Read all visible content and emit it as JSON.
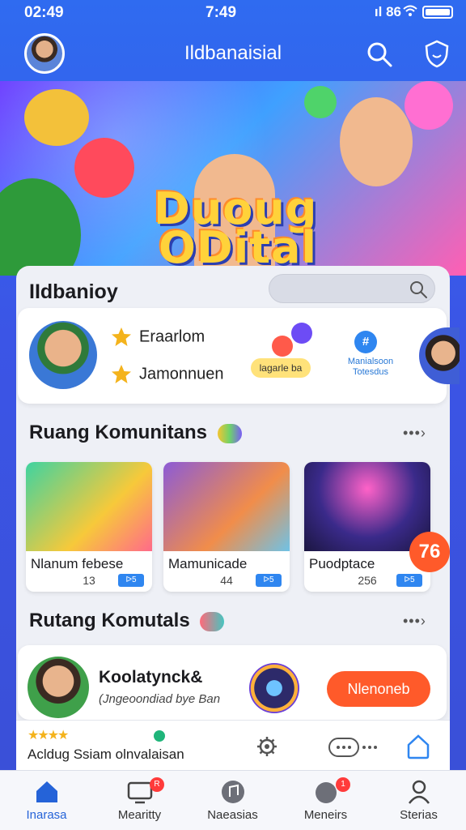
{
  "status_bar": {
    "time_left": "02:49",
    "time_center": "7:49",
    "signal": "ıl 86"
  },
  "header": {
    "title": "Ildbanaisial"
  },
  "hero": {
    "title_line1": "Duoug",
    "title_line2": "ODital"
  },
  "panel": {
    "heading": "IIdbanioy",
    "search_placeholder": ""
  },
  "profile_card": {
    "stat1": "Eraarlom",
    "stat2": "Jamonnuen",
    "pill_label": "lagarle ba",
    "info_label": "Manialsoon Totesdus",
    "info_icon": "#"
  },
  "sections": [
    {
      "title": "Ruang Komunitans",
      "see_all": "•••›"
    },
    {
      "title": "Rutang Komutals",
      "see_all": "•••›"
    }
  ],
  "rooms": [
    {
      "name": "Nlanum febese",
      "count": "13",
      "badge": "ᐅ5"
    },
    {
      "name": "Mamunicade",
      "count": "44",
      "badge": "ᐅ5"
    },
    {
      "name": "Puodptace",
      "count": "256",
      "badge": "ᐅ5"
    }
  ],
  "hot_badge": "76",
  "bottom_card": {
    "username": "Koolatynck&",
    "description": "(Jngeoondiad bye Ban",
    "cta": "Nlenoneb"
  },
  "review": {
    "stars": "★★★★",
    "text": "Acldug Ssiam olnvalaisan"
  },
  "bottom_nav": [
    {
      "label": "Inarasa",
      "icon": "home-icon"
    },
    {
      "label": "Mearitty",
      "icon": "monitor-icon",
      "badge": "R"
    },
    {
      "label": "Naeasias",
      "icon": "music-icon"
    },
    {
      "label": "Meneirs",
      "icon": "bell-icon",
      "badge": "1"
    },
    {
      "label": "Sterias",
      "icon": "profile-icon"
    }
  ],
  "colors": {
    "accent": "#2f6bf0",
    "cta": "#ff5a2a",
    "badge_blue": "#2f86f0"
  }
}
